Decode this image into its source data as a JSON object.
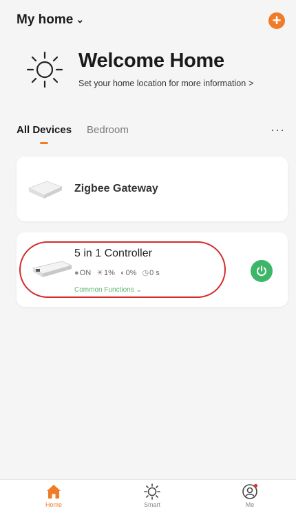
{
  "header": {
    "home_name": "My home",
    "chevron": "⌄",
    "add_icon": "plus-icon"
  },
  "welcome": {
    "title": "Welcome Home",
    "subtitle": "Set your home location for more information",
    "arrow": ">"
  },
  "tabs": [
    {
      "label": "All Devices",
      "active": true
    },
    {
      "label": "Bedroom",
      "active": false
    }
  ],
  "more": "···",
  "devices": [
    {
      "name": "Zigbee Gateway"
    },
    {
      "name": "5 in 1 Controller",
      "status": {
        "power": "ON",
        "brightness": "1%",
        "temperature": "0%",
        "timer": "0 s"
      },
      "common_functions": "Common Functions ⌄",
      "power_on": true
    }
  ],
  "colors": {
    "accent": "#f07c2a",
    "power": "#3db66a",
    "highlight": "#d42a2a"
  },
  "tabbar": [
    {
      "label": "Home",
      "icon": "home-icon",
      "active": true
    },
    {
      "label": "Smart",
      "icon": "sun-icon",
      "active": false
    },
    {
      "label": "Me",
      "icon": "profile-icon",
      "active": false
    }
  ]
}
